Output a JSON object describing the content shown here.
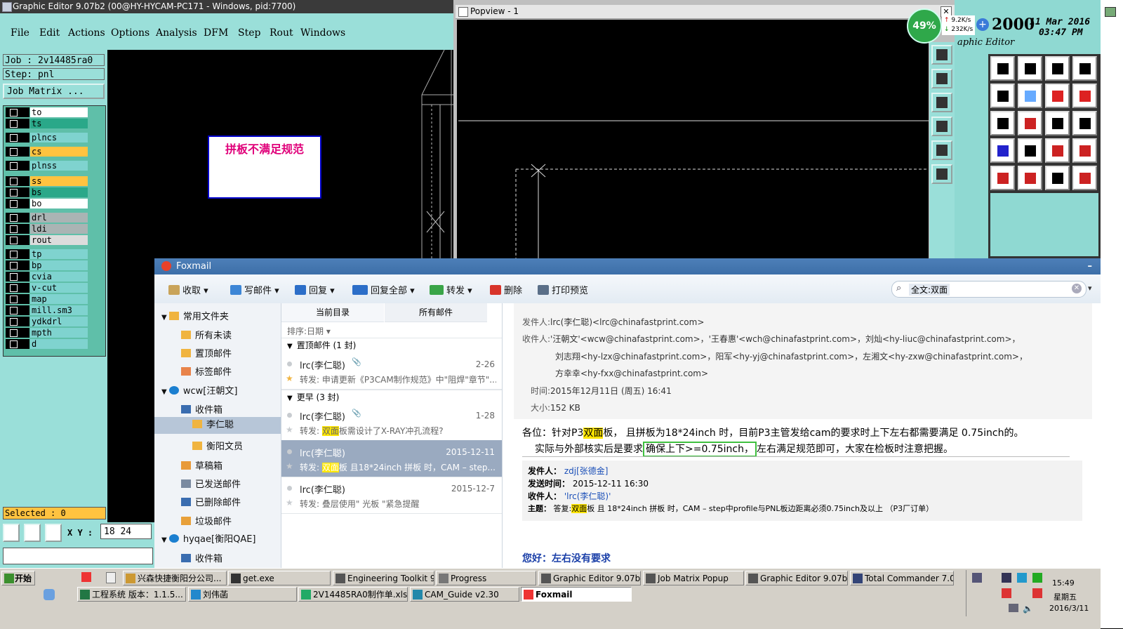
{
  "graphic_editor": {
    "title": "Graphic Editor 9.07b2 (00@HY-HYCAM-PC171 - Windows, pid:7700)",
    "menu": [
      "File",
      "Edit",
      "Actions",
      "Options",
      "Analysis",
      "DFM",
      "Step",
      "Rout",
      "Windows"
    ],
    "job": "Job : 2v14485ra0",
    "step": "Step: pnl",
    "job_matrix": "Job Matrix ...",
    "layers": [
      {
        "name": "to",
        "color": "#ffffff"
      },
      {
        "name": "ts",
        "color": "#2aa889"
      },
      {
        "name": "plncs",
        "color": "#7fd3cf"
      },
      {
        "name": "cs",
        "color": "#ffc340"
      },
      {
        "name": "plnss",
        "color": "#7fd3cf"
      },
      {
        "name": "ss",
        "color": "#ffc340"
      },
      {
        "name": "bs",
        "color": "#2aa889"
      },
      {
        "name": "bo",
        "color": "#ffffff"
      },
      {
        "name": "drl",
        "color": "#aab4b4"
      },
      {
        "name": "ldi",
        "color": "#aab4b4"
      },
      {
        "name": "rout",
        "color": "#dcdcdc"
      },
      {
        "name": "tp",
        "color": "#7fd3cf"
      },
      {
        "name": "bp",
        "color": "#7fd3cf"
      },
      {
        "name": "cvia",
        "color": "#7fd3cf"
      },
      {
        "name": "v-cut",
        "color": "#7fd3cf"
      },
      {
        "name": "map",
        "color": "#7fd3cf"
      },
      {
        "name": "mill.sm3",
        "color": "#7fd3cf"
      },
      {
        "name": "ydkdrl",
        "color": "#7fd3cf"
      },
      {
        "name": "mpth",
        "color": "#7fd3cf"
      },
      {
        "name": "d",
        "color": "#7fd3cf"
      }
    ],
    "selected": "Selected : 0",
    "xy_label": "X Y :",
    "xy_value": "18 24",
    "message": "拼板不满足规范"
  },
  "popview": {
    "title": "Popview - 1"
  },
  "status": {
    "cpu_percent": "49%",
    "upload": "9.2K/s",
    "download": "232K/s",
    "year": "2000",
    "date": "11 Mar 2016",
    "time": "03:47 PM",
    "app_label": "aphic Editor"
  },
  "foxmail": {
    "title": "Foxmail",
    "toolbar": [
      "收取",
      "写邮件",
      "回复",
      "回复全部",
      "转发",
      "删除",
      "打印预览"
    ],
    "search_value": "全文:双面",
    "folders": [
      {
        "label": "常用文件夹",
        "level": 0
      },
      {
        "label": "所有未读",
        "level": 1
      },
      {
        "label": "置顶邮件",
        "level": 1
      },
      {
        "label": "标签邮件",
        "level": 1
      },
      {
        "label": "wcw[汪朝文]",
        "level": 0
      },
      {
        "label": "收件箱",
        "level": 1
      },
      {
        "label": "李仁聪",
        "level": 2
      },
      {
        "label": "衡阳文员",
        "level": 2
      },
      {
        "label": "草稿箱",
        "level": 1
      },
      {
        "label": "已发送邮件",
        "level": 1
      },
      {
        "label": "已删除邮件",
        "level": 1
      },
      {
        "label": "垃圾邮件",
        "level": 1
      },
      {
        "label": "hyqae[衡阳QAE]",
        "level": 0
      },
      {
        "label": "收件箱",
        "level": 1
      }
    ],
    "list_tabs": [
      "当前目录",
      "所有邮件"
    ],
    "sort_label": "排序:日期",
    "group_pinned": "置顶邮件 (1 封)",
    "group_earlier": "更早 (3 封)",
    "messages": [
      {
        "from": "lrc(李仁聪)",
        "date": "2-26",
        "pre": "转发: 申请更新《P3CAM制作规范》中\"阻焊\"章节\"...",
        "hl": "",
        "post": ""
      },
      {
        "from": "lrc(李仁聪)",
        "date": "1-28",
        "pre": "转发: ",
        "hl": "双面",
        "post": "板需设计了X-RAY冲孔流程?"
      },
      {
        "from": "lrc(李仁聪)",
        "date": "2015-12-11",
        "pre": "转发: ",
        "hl": "双面",
        "post": "板 且18*24inch 拼板 时，CAM – step..."
      },
      {
        "from": "lrc(李仁聪)",
        "date": "2015-12-7",
        "pre": "转发: 叠层使用\" 光板 \"紧急提醒",
        "hl": "",
        "post": ""
      }
    ],
    "header": {
      "from": "lrc(李仁聪)<lrc@chinafastprint.com>",
      "to_lines": [
        "'汪朝文'<wcw@chinafastprint.com>，'王春惠'<wch@chinafastprint.com>，刘灿<hy-liuc@chinafastprint.com>，",
        "刘志翔<hy-lzx@chinafastprint.com>，阳军<hy-yj@chinafastprint.com>，左湘文<hy-zxw@chinafastprint.com>，",
        "方幸幸<hy-fxx@chinafastprint.com>"
      ],
      "time": "2015年12月11日 (周五) 16:41",
      "size": "152 KB",
      "labels": {
        "from": "发件人:",
        "to": "收件人:",
        "time": "时间:",
        "size": "大小:"
      }
    },
    "body": {
      "line1_a": "各位：针对P3",
      "line1_hl": "双面",
      "line1_b": "板， 且拼板为18*24inch 时，目前P3主管发给cam的要求时上下左右都需要满足 0.75inch的。",
      "line2_a": "实际与外部核实后是要求",
      "line2_box": "确保上下>=0.75inch，",
      "line2_b": "左右满足规范即可，大家在检板时注意把握。"
    },
    "fwd": {
      "from_label": "发件人：",
      "from": "zdj[张德金]",
      "time_label": "发送时间：",
      "time": "2015-12-11 16:30",
      "to_label": "收件人：",
      "to": "'lrc(李仁聪)'",
      "subj_label": "主题：",
      "subj_a": "答复:",
      "subj_hl": "双面",
      "subj_b": "板 且 18*24inch 拼板 时，CAM – step中profile与PNL板边距离必须0.75inch及以上 （P3厂订单）"
    },
    "reply": "您好：左右没有要求"
  },
  "taskbar": {
    "start": "开始",
    "row1": [
      "兴森快捷衡阳分公司...",
      "get.exe",
      "Engineering Toolkit 9.0...",
      "Progress",
      "Graphic Editor 9.07b2 (...",
      "Job Matrix Popup",
      "Graphic Editor 9.07b2 ...",
      "Total Commander 7.0 ..."
    ],
    "row2": [
      "工程系统  版本：1.1.5...",
      "刘伟菡",
      "2V14485RA0制作单.xls ...",
      "CAM_Guide v2.30",
      "Foxmail"
    ],
    "clock_time": "15:49",
    "clock_day": "星期五",
    "clock_date": "2016/3/11"
  }
}
